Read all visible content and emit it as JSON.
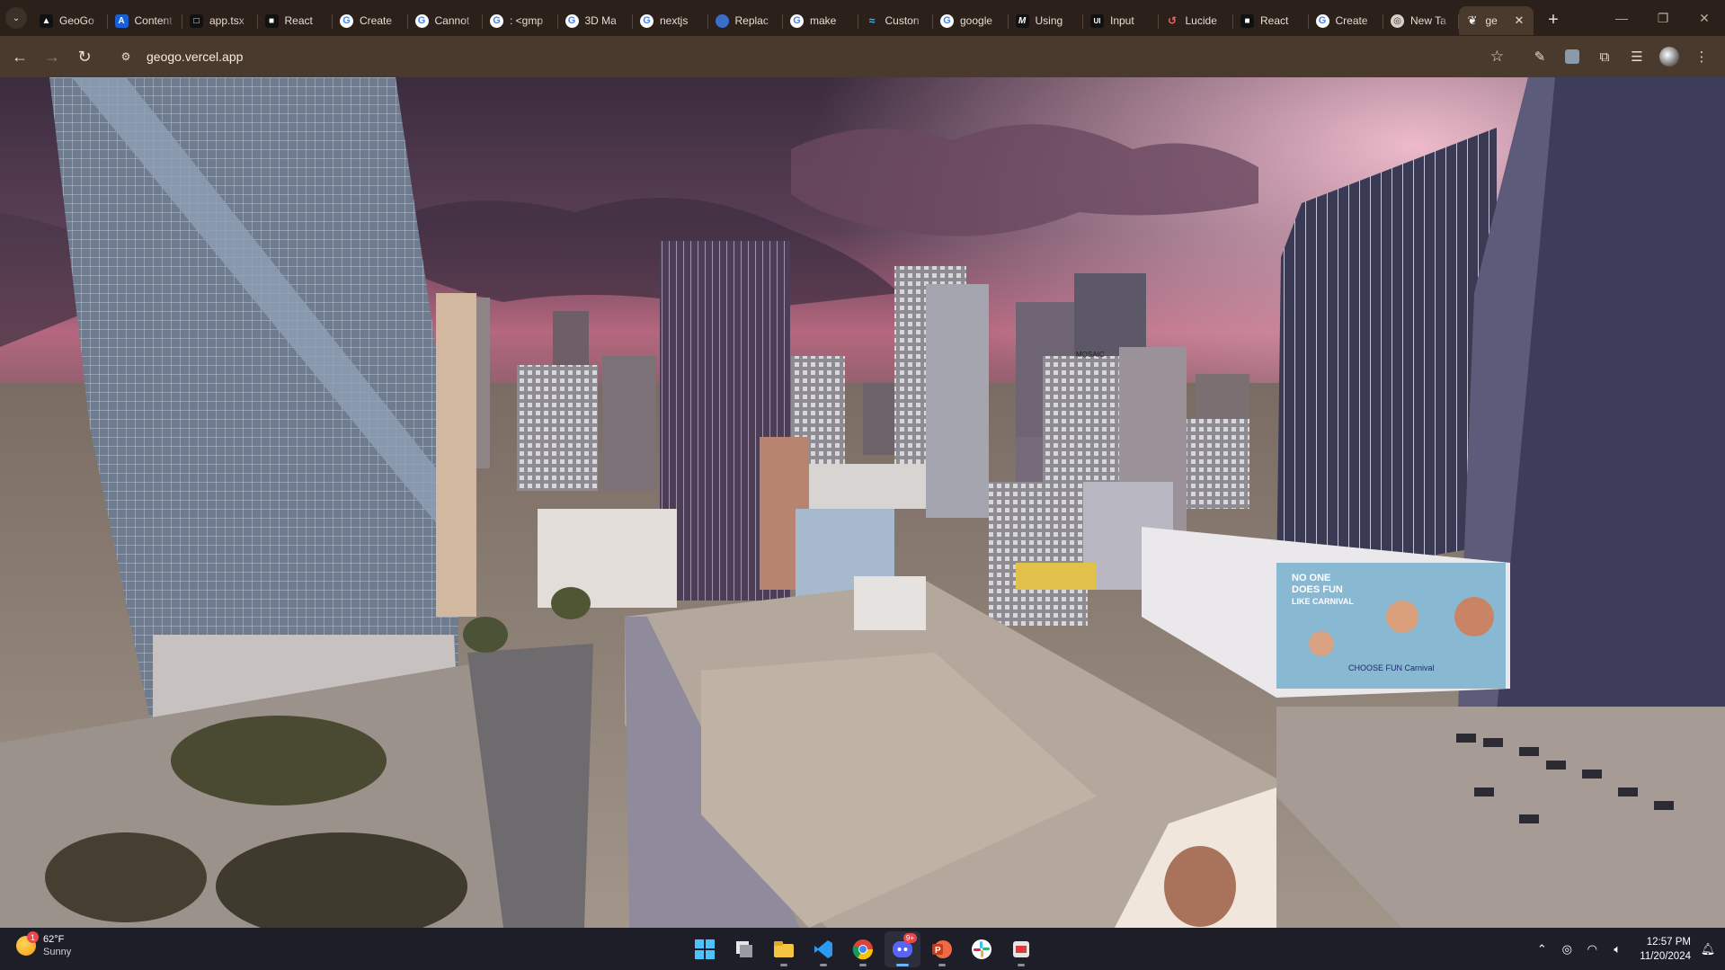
{
  "browser": {
    "tabs": [
      {
        "title": "GeoGo",
        "icon": "triangle-icon"
      },
      {
        "title": "Content",
        "icon": "a-icon"
      },
      {
        "title": "app.tsx",
        "icon": "square-icon"
      },
      {
        "title": "React",
        "icon": "square-icon"
      },
      {
        "title": "Create",
        "icon": "google-icon"
      },
      {
        "title": "Cannot",
        "icon": "google-icon"
      },
      {
        "title": ": <gmp",
        "icon": "google-icon"
      },
      {
        "title": "3D Ma",
        "icon": "google-icon"
      },
      {
        "title": "nextjs",
        "icon": "google-icon"
      },
      {
        "title": "Replac",
        "icon": "replit-icon"
      },
      {
        "title": "make",
        "icon": "google-icon"
      },
      {
        "title": "Custon",
        "icon": "tailwind-icon"
      },
      {
        "title": "google",
        "icon": "google-icon"
      },
      {
        "title": "Using",
        "icon": "m-icon"
      },
      {
        "title": "Input",
        "icon": "ui-icon"
      },
      {
        "title": "Lucide",
        "icon": "lucide-icon"
      },
      {
        "title": "React",
        "icon": "square-icon"
      },
      {
        "title": "Create",
        "icon": "google-icon"
      },
      {
        "title": "New Ta",
        "icon": "chrome-icon"
      },
      {
        "title": "ge",
        "icon": "geogo-icon",
        "active": true
      }
    ],
    "address": "geogo.vercel.app"
  },
  "taskbar": {
    "weather": {
      "temp": "62°F",
      "condition": "Sunny",
      "badge": "1"
    },
    "discord_badge": "9+",
    "time": "12:57 PM",
    "date": "11/20/2024"
  },
  "scene": {
    "billboard_line1": "NO ONE",
    "billboard_line2": "DOES FUN",
    "billboard_line3": "LIKE CARNIVAL",
    "billboard_brand": "CHOOSE FUN Carnival",
    "rooftop_sign": "MOSAIC"
  }
}
